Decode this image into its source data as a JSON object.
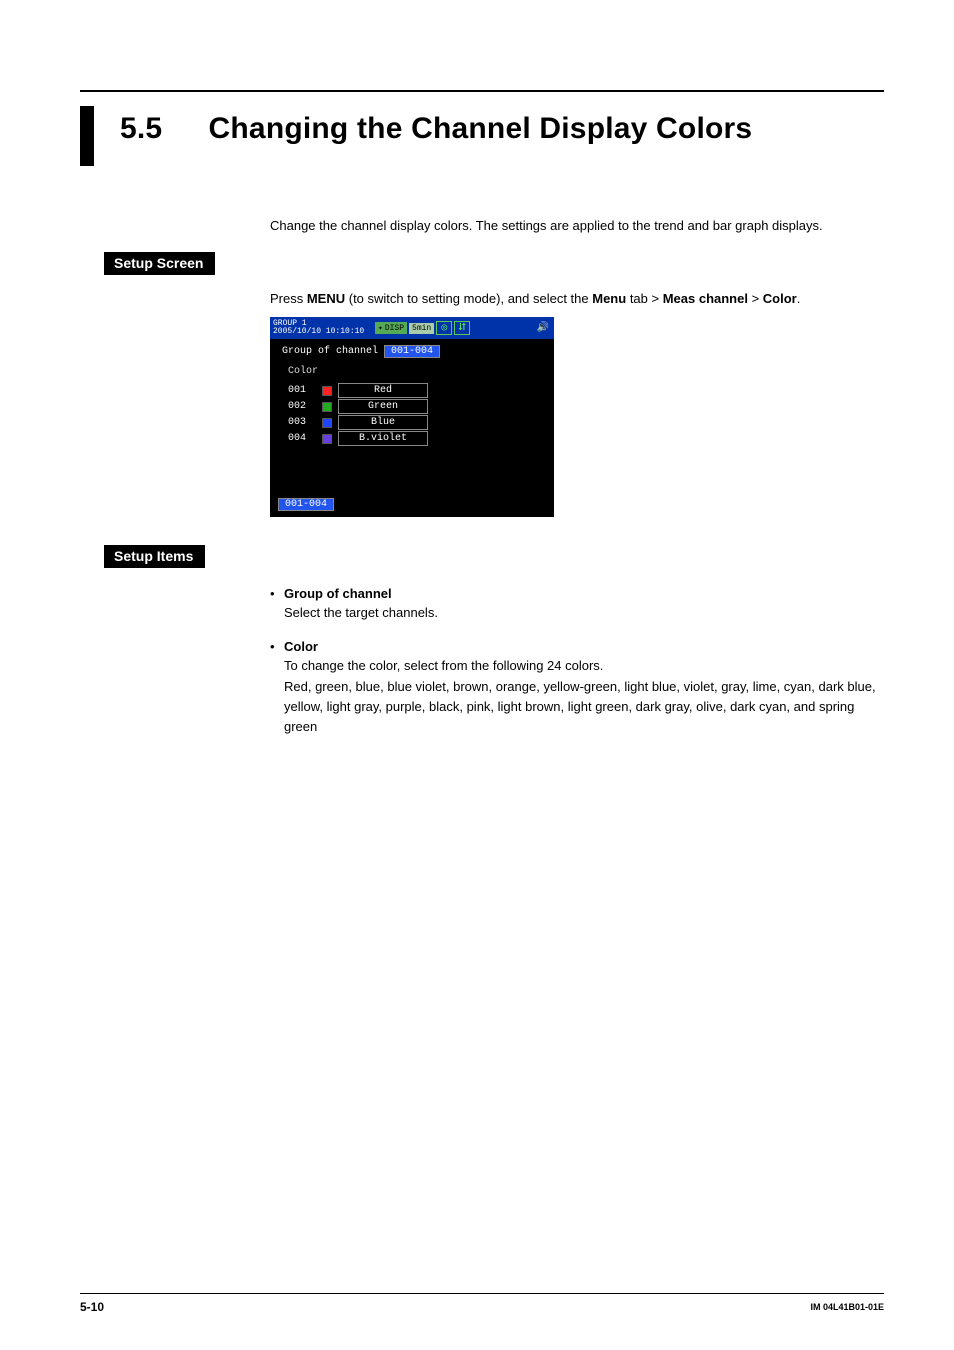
{
  "section": {
    "number": "5.5",
    "title": "Changing the Channel Display Colors"
  },
  "intro": "Change the channel display colors. The settings are applied to the trend and bar graph displays.",
  "labels": {
    "setup_screen": "Setup Screen",
    "setup_items": "Setup Items"
  },
  "setup_screen": {
    "prefix": "Press ",
    "menu1": "MENU",
    "mid1": " (to switch to setting mode), and select the ",
    "menu2": "Menu",
    "mid2": " tab > ",
    "menu3": "Meas channel",
    "mid3": " > ",
    "menu4": "Color",
    "suffix": "."
  },
  "screenshot": {
    "group_line1": "GROUP 1",
    "group_line2": "2005/10/10 10:10:10",
    "disp": "DISP",
    "interval": "5min",
    "row_label": "Group of channel",
    "row_value": "001-004",
    "subhead": "Color",
    "rows": [
      {
        "ch": "001",
        "color": "#ff2222",
        "name": "Red"
      },
      {
        "ch": "002",
        "color": "#22aa22",
        "name": "Green"
      },
      {
        "ch": "003",
        "color": "#2244ff",
        "name": "Blue"
      },
      {
        "ch": "004",
        "color": "#6a3fe0",
        "name": "B.violet"
      }
    ],
    "footer": "001-004"
  },
  "items": {
    "group": {
      "title": "Group of channel",
      "body": "Select the target channels."
    },
    "color": {
      "title": "Color",
      "line1": "To change the color, select from the following 24 colors.",
      "line2": "Red, green, blue, blue violet, brown, orange, yellow-green, light blue, violet, gray, lime, cyan, dark blue, yellow, light gray, purple, black, pink, light brown, light green, dark gray, olive, dark cyan, and spring green"
    }
  },
  "footer": {
    "page": "5-10",
    "doc": "IM 04L41B01-01E"
  }
}
